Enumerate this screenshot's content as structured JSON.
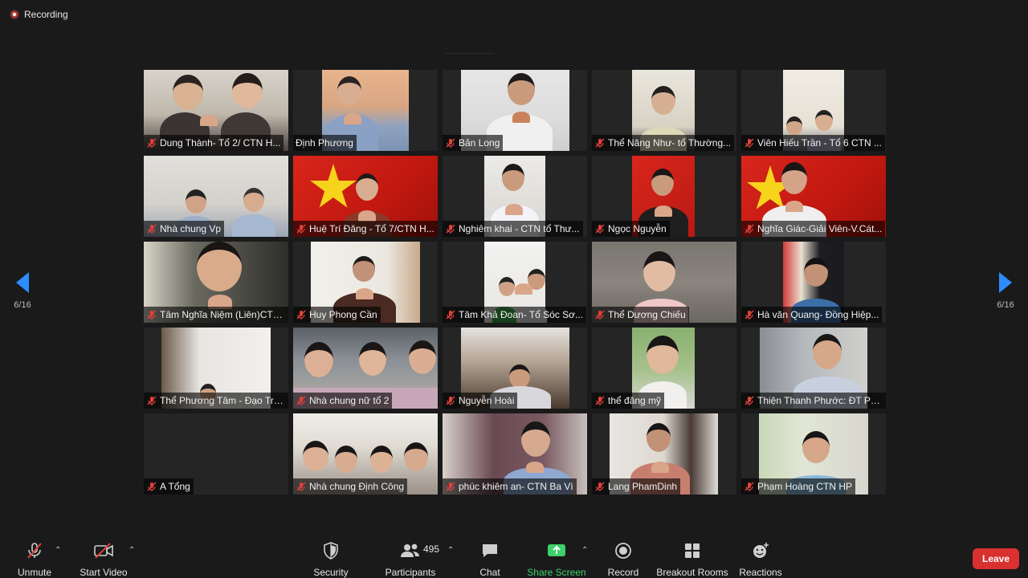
{
  "recording": {
    "label": "Recording"
  },
  "pagination": {
    "left": "6/16",
    "right": "6/16"
  },
  "colors": {
    "accent": "#2d8cff",
    "muted_red": "#e0413a",
    "share_green": "#3ed16b",
    "leave_red": "#d93030"
  },
  "participants": [
    {
      "name": "Dung Thành- Tổ 2/ CTN H...",
      "muted": true
    },
    {
      "name": "Định Phương",
      "muted": false
    },
    {
      "name": "Bản Long",
      "muted": true
    },
    {
      "name": "Thể Năng Như- tổ Thường...",
      "muted": true
    },
    {
      "name": "Viên Hiếu Trần - Tổ 6 CTN ...",
      "muted": true
    },
    {
      "name": "Nhà chung Vp",
      "muted": true
    },
    {
      "name": "Huệ Trí Đăng - Tổ 7/CTN H...",
      "muted": true
    },
    {
      "name": "Nghiêm khai - CTN tổ Thư...",
      "muted": true
    },
    {
      "name": "Ngọc Nguyễn",
      "muted": true
    },
    {
      "name": "Nghĩa Giác-Giải Viên-V.Cát...",
      "muted": true
    },
    {
      "name": "Tâm Nghĩa Niệm (Liên)CTN...",
      "muted": true
    },
    {
      "name": "Huy Phong Cần",
      "muted": true
    },
    {
      "name": "Tâm Khả Đoan- Tổ Sóc Sơ...",
      "muted": true
    },
    {
      "name": "Thể Dương Chiếu",
      "muted": true
    },
    {
      "name": "Hà văn Quang- Đồng Hiệp...",
      "muted": true
    },
    {
      "name": "Thể Phương Tâm - Đạo Trà...",
      "muted": true
    },
    {
      "name": "Nhà chung nữ tổ 2",
      "muted": true
    },
    {
      "name": "Nguyễn Hoài",
      "muted": true
    },
    {
      "name": "thể đăng mỹ",
      "muted": true
    },
    {
      "name": "Thiện Thanh Phước: ĐT Phậ...",
      "muted": true
    },
    {
      "name": "A Tổng",
      "muted": true
    },
    {
      "name": "Nhà chung Định Công",
      "muted": true
    },
    {
      "name": "phúc khiêm an- CTN Ba Vì",
      "muted": true
    },
    {
      "name": "Lang PhamDinh",
      "muted": true
    },
    {
      "name": "Phạm Hoàng CTN HP",
      "muted": true
    }
  ],
  "toolbar": {
    "unmute": "Unmute",
    "start_video": "Start Video",
    "security": "Security",
    "participants": "Participants",
    "participant_count": "495",
    "chat": "Chat",
    "share_screen": "Share Screen",
    "record": "Record",
    "breakout_rooms": "Breakout Rooms",
    "reactions": "Reactions",
    "leave": "Leave"
  }
}
